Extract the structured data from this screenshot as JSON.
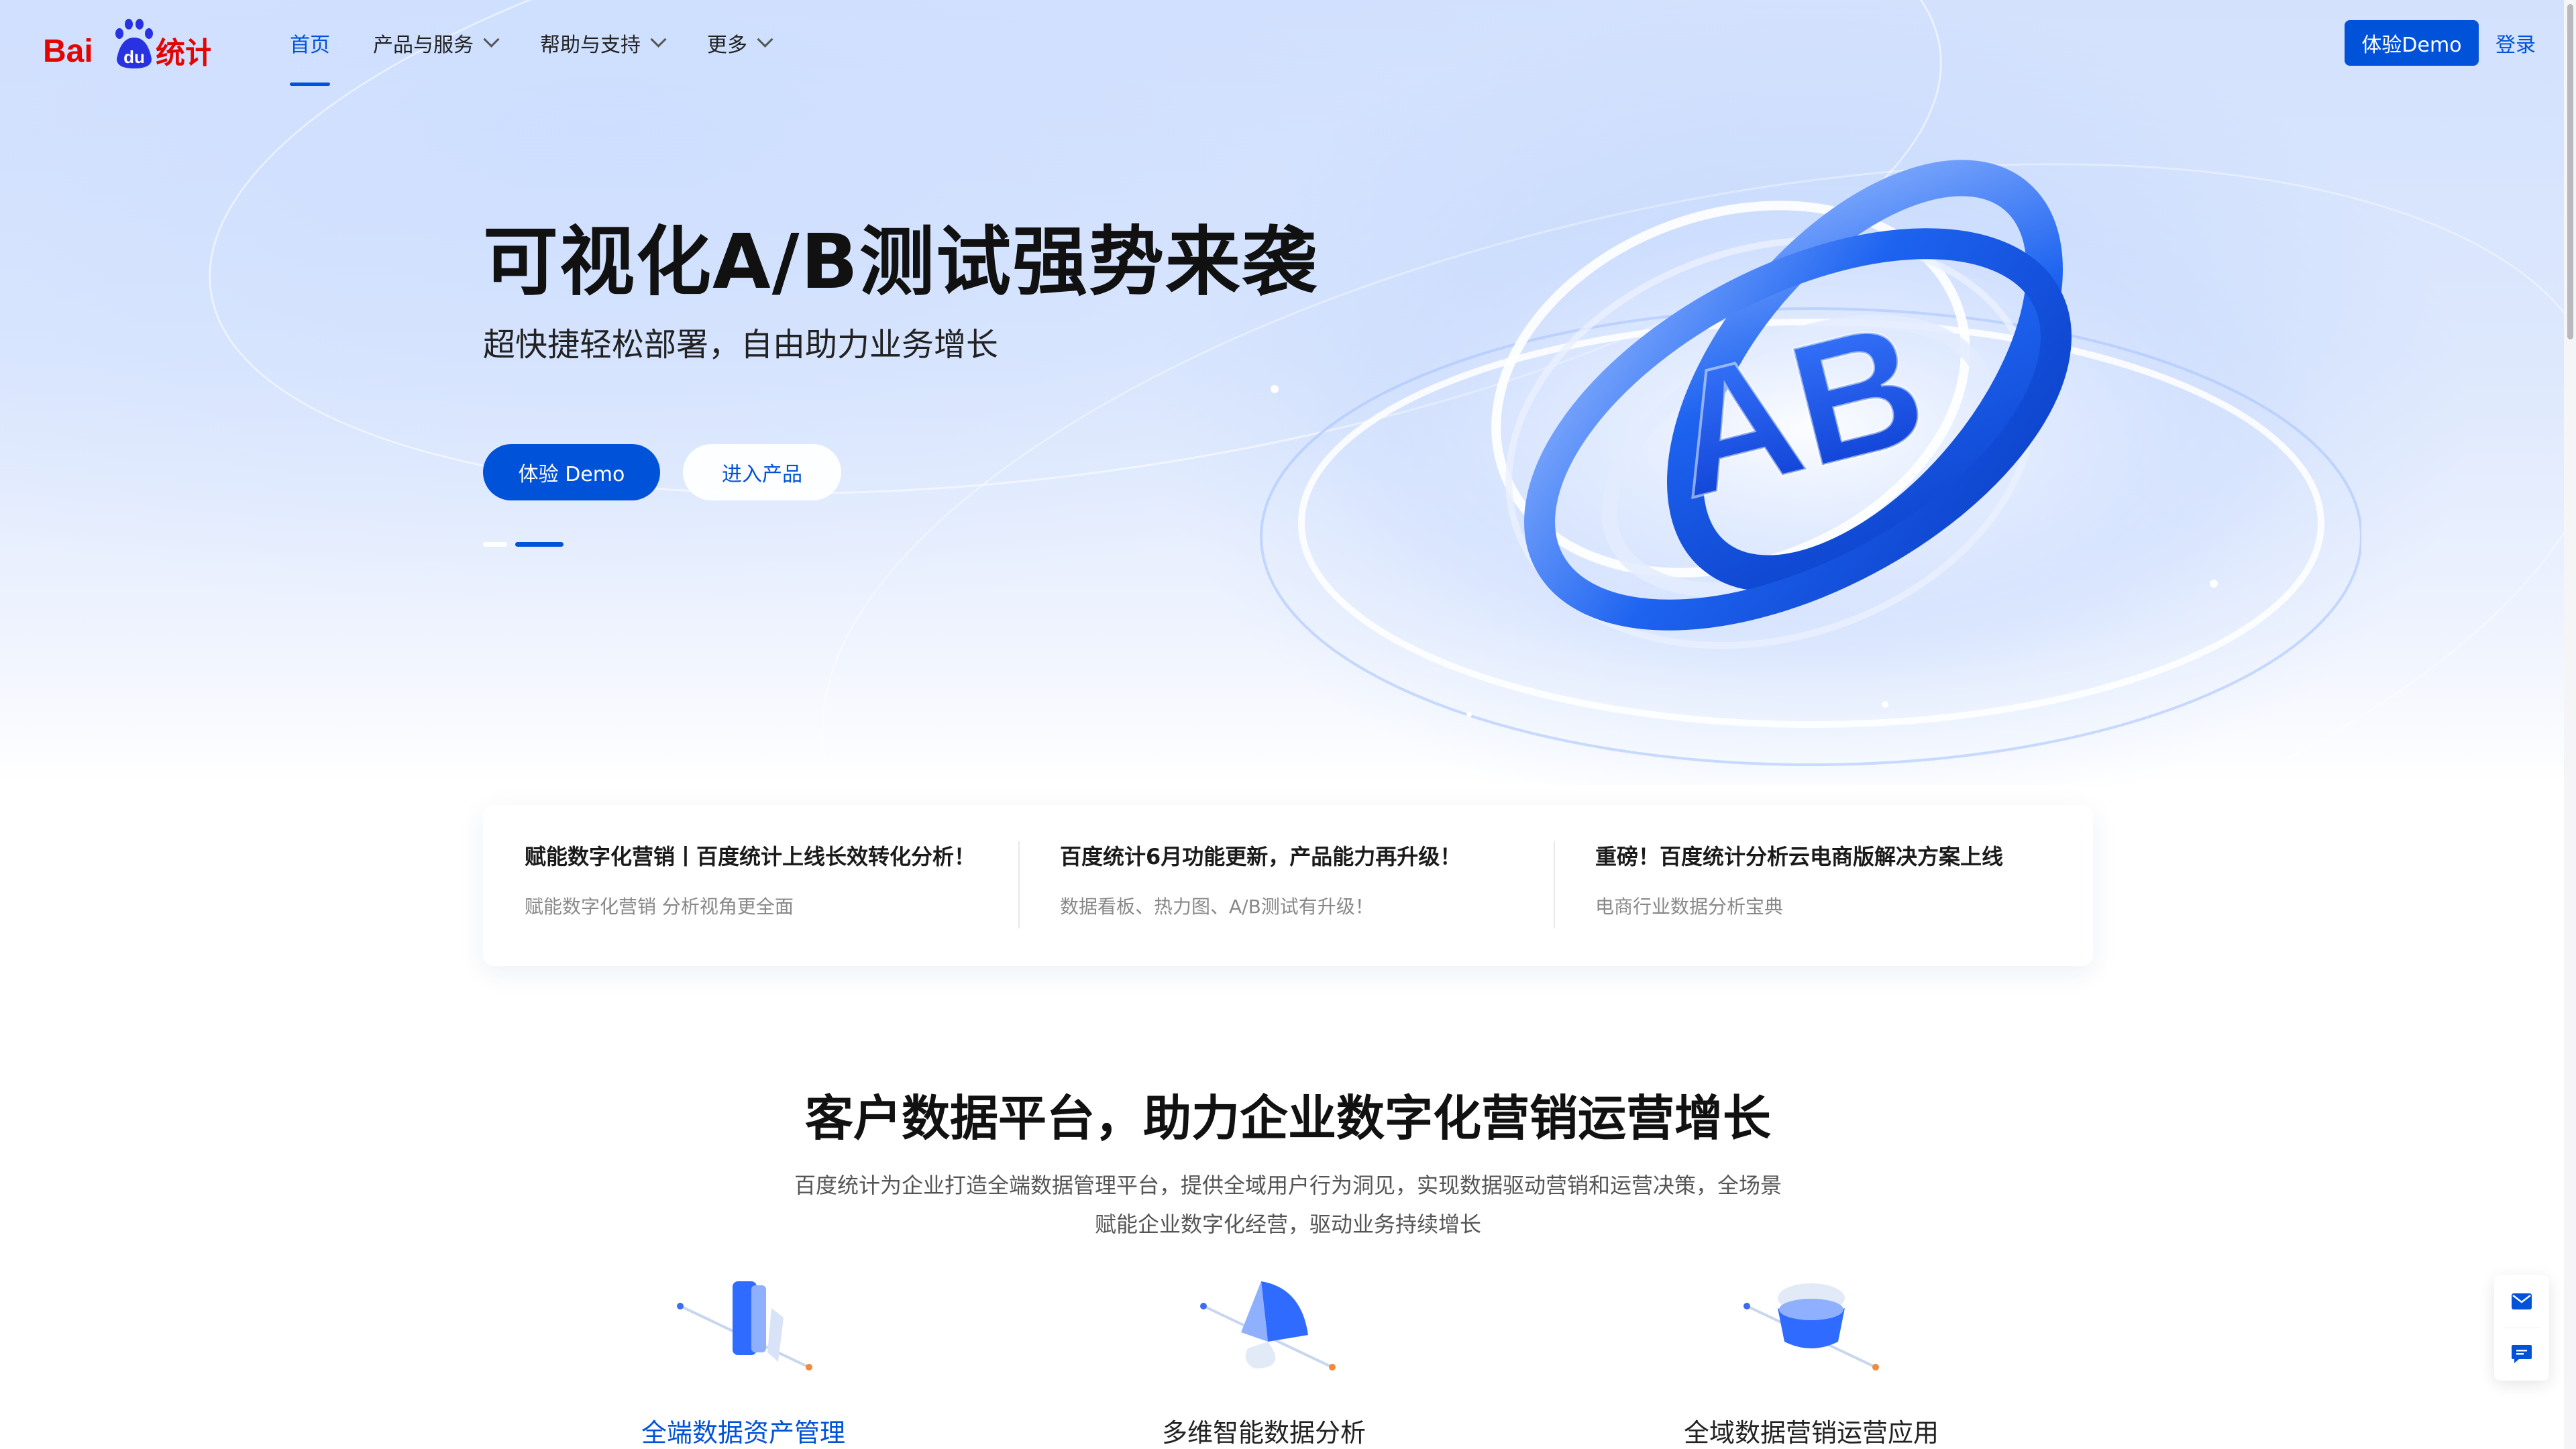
{
  "header": {
    "logo_text": "Bai du 统计",
    "nav": [
      {
        "label": "首页",
        "active": true,
        "has_dropdown": false
      },
      {
        "label": "产品与服务",
        "active": false,
        "has_dropdown": true
      },
      {
        "label": "帮助与支持",
        "active": false,
        "has_dropdown": true
      },
      {
        "label": "更多",
        "active": false,
        "has_dropdown": true
      }
    ],
    "demo_button": "体验Demo",
    "login_link": "登录"
  },
  "hero": {
    "title": "可视化A/B测试强势来袭",
    "subtitle": "超快捷轻松部署，自由助力业务增长",
    "primary_button": "体验 Demo",
    "secondary_button": "进入产品",
    "art_text": "AB",
    "carousel_active_index": 1,
    "carousel_count": 2
  },
  "news": [
    {
      "title": "赋能数字化营销丨百度统计上线长效转化分析！",
      "desc": "赋能数字化营销 分析视角更全面"
    },
    {
      "title": "百度统计6月功能更新，产品能力再升级！",
      "desc": "数据看板、热力图、A/B测试有升级！"
    },
    {
      "title": "重磅！百度统计分析云电商版解决方案上线",
      "desc": "电商行业数据分析宝典"
    }
  ],
  "platform": {
    "title": "客户数据平台，助力企业数字化营销运营增长",
    "desc_line1": "百度统计为企业打造全端数据管理平台，提供全域用户行为洞见，实现数据驱动营销和运营决策，全场景",
    "desc_line2": "赋能企业数字化经营，驱动业务持续增长",
    "features": [
      {
        "label": "全端数据资产管理",
        "active": true,
        "icon": "data-asset-icon"
      },
      {
        "label": "多维智能数据分析",
        "active": false,
        "icon": "data-analysis-icon"
      },
      {
        "label": "全域数据营销运营应用",
        "active": false,
        "icon": "marketing-icon"
      }
    ]
  },
  "float_tools": [
    "mail-icon",
    "chat-icon"
  ],
  "colors": {
    "brand_blue": "#0052d9",
    "logo_red": "#e10602",
    "logo_blue": "#2932e1"
  }
}
